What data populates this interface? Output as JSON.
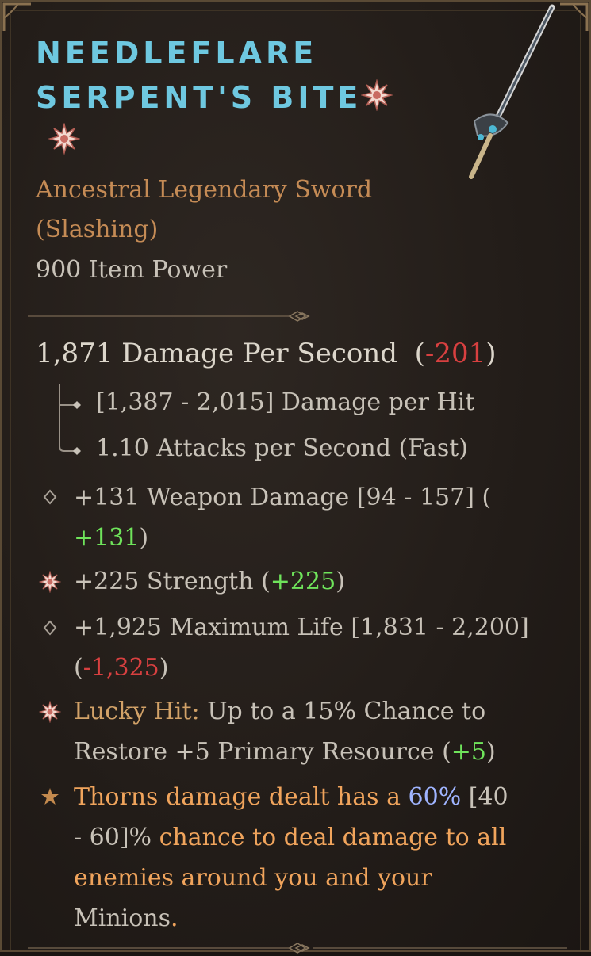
{
  "item": {
    "name_line1": "NEEDLEFLARE",
    "name_line2": "SERPENT'S BITE",
    "type_line1": "Ancestral Legendary Sword",
    "type_line2": "(Slashing)",
    "item_power": "900 Item Power"
  },
  "dps": {
    "label": "1,871 Damage Per Second",
    "delta": "-201"
  },
  "damage_per_hit": "[1,387 - 2,015] Damage per Hit",
  "attacks_per_second": "1.10 Attacks per Second (Fast)",
  "affixes": {
    "weapon_damage": {
      "text": "+131 Weapon Damage [94 - 157] (",
      "delta": "+131"
    },
    "strength": {
      "text": "+225 Strength (",
      "delta": "+225"
    },
    "max_life": {
      "text": "+1,925 Maximum Life [1,831 - 2,200]",
      "delta": "-1,325"
    },
    "lucky_hit": {
      "label": "Lucky Hit:",
      "text1": "Up to a 15% Chance to",
      "text2": "Restore +5 Primary Resource (",
      "delta": "+5"
    },
    "legendary": {
      "part1": "Thorns damage dealt has a",
      "value": "60%",
      "range_a": "[40",
      "range_b": "- 60]%",
      "part2": "chance to deal damage to all",
      "line3": "enemies around you and your",
      "line4": "Minions",
      "period": "."
    }
  },
  "icons": [
    "greater-affix-star-icon",
    "diamond-bullet-icon",
    "legendary-star-icon",
    "sword-icon"
  ],
  "colors": {
    "title": "#6ec8e0",
    "type": "#c58b55",
    "negative": "#d84040",
    "positive": "#6fe45b",
    "legendary": "#f0a45c",
    "value": "#9fb4ff"
  }
}
